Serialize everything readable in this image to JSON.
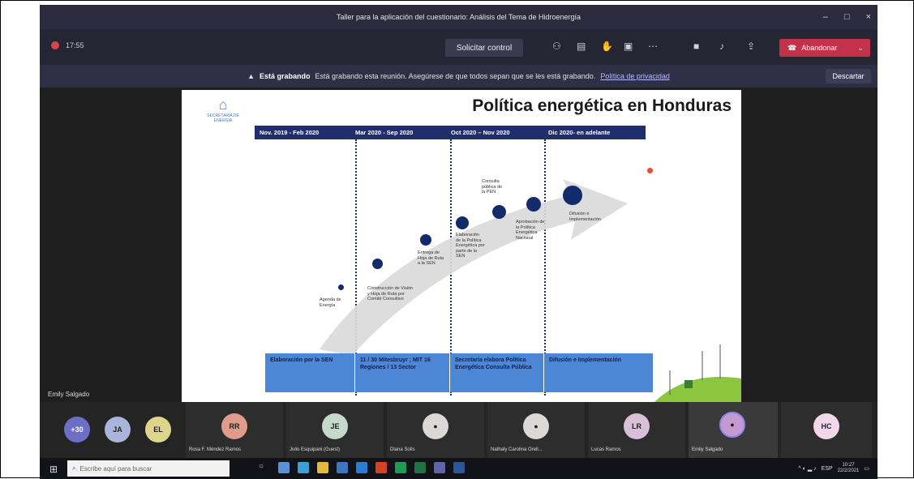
{
  "window": {
    "title": "Taller para la aplicación del cuestionario: Análisis del Tema de Hidroenergía",
    "controls": [
      "–",
      "□",
      "×"
    ]
  },
  "toolbar": {
    "timer": "17:55",
    "request_control": "Solicitar control",
    "hangup": "Abandonar",
    "hangup_color": "#c4314b"
  },
  "banner": {
    "bold": "Está grabando",
    "text": "Está grabando esta reunión. Asegúrese de que todos sepan que se les está grabando.",
    "link": "Política de privacidad",
    "dismiss": "Descartar"
  },
  "stage": {
    "presenter": "Emily Salgado"
  },
  "slide": {
    "title": "Política energética en Honduras",
    "logo_text": "SECRETARÍA DE ENERGÍA",
    "phases": [
      {
        "head": "Nov. 2019 - Feb 2020",
        "foot": "Elaboración por la SEN"
      },
      {
        "head": "Mar 2020 - Sep 2020",
        "foot": "11 / 30 Mitesbruyr ; MIT 16 Regiones / 13 Sector"
      },
      {
        "head": "Oct 2020 – Nov 2020",
        "foot": "Secretaría elabora Política Energética Consulta Pública"
      },
      {
        "head": "Dic 2020- en adelante",
        "foot": "Difusión e Implementación"
      }
    ],
    "steps": [
      "Agenda de Energía",
      "Construcción de Visión y Hoja de Ruta por Comité Consultivo",
      "Entrega de Hoja de Ruta a la SEN",
      "Elaboración de la Política Energética por parte de la SEN",
      "Consulta pública de la PEN",
      "Aprobación de la Política Energética Nacional",
      "Difusión e Implementación"
    ]
  },
  "participants": {
    "overflow": "+30",
    "small": [
      {
        "initials": "JA",
        "color": "#a9b6d9"
      },
      {
        "initials": "EL",
        "color": "#ddd58a"
      }
    ],
    "tiles": [
      {
        "initials": "RR",
        "name": "Rosa F. Méndez Ramos",
        "color": "#e09c8a"
      },
      {
        "initials": "JE",
        "name": "Julio Esquipani (Guest)",
        "color": "#c5dacc"
      },
      {
        "initials": "",
        "name": "Diana Solís",
        "color": "#dcd8d8"
      },
      {
        "initials": "",
        "name": "Nathaly Carolina Orell...",
        "color": "#dcd8d8"
      },
      {
        "initials": "LR",
        "name": "Lucas Ramos",
        "color": "#d8c0d8"
      },
      {
        "initials": "",
        "name": "Emily Salgado",
        "color": "#c59ad3"
      },
      {
        "initials": "HC",
        "name": "",
        "color": "#f0d8ea"
      }
    ]
  },
  "taskbar": {
    "search_placeholder": "Escribe aquí para buscar",
    "time": "10:27",
    "date": "22/2/2021",
    "lang": "ESP"
  }
}
